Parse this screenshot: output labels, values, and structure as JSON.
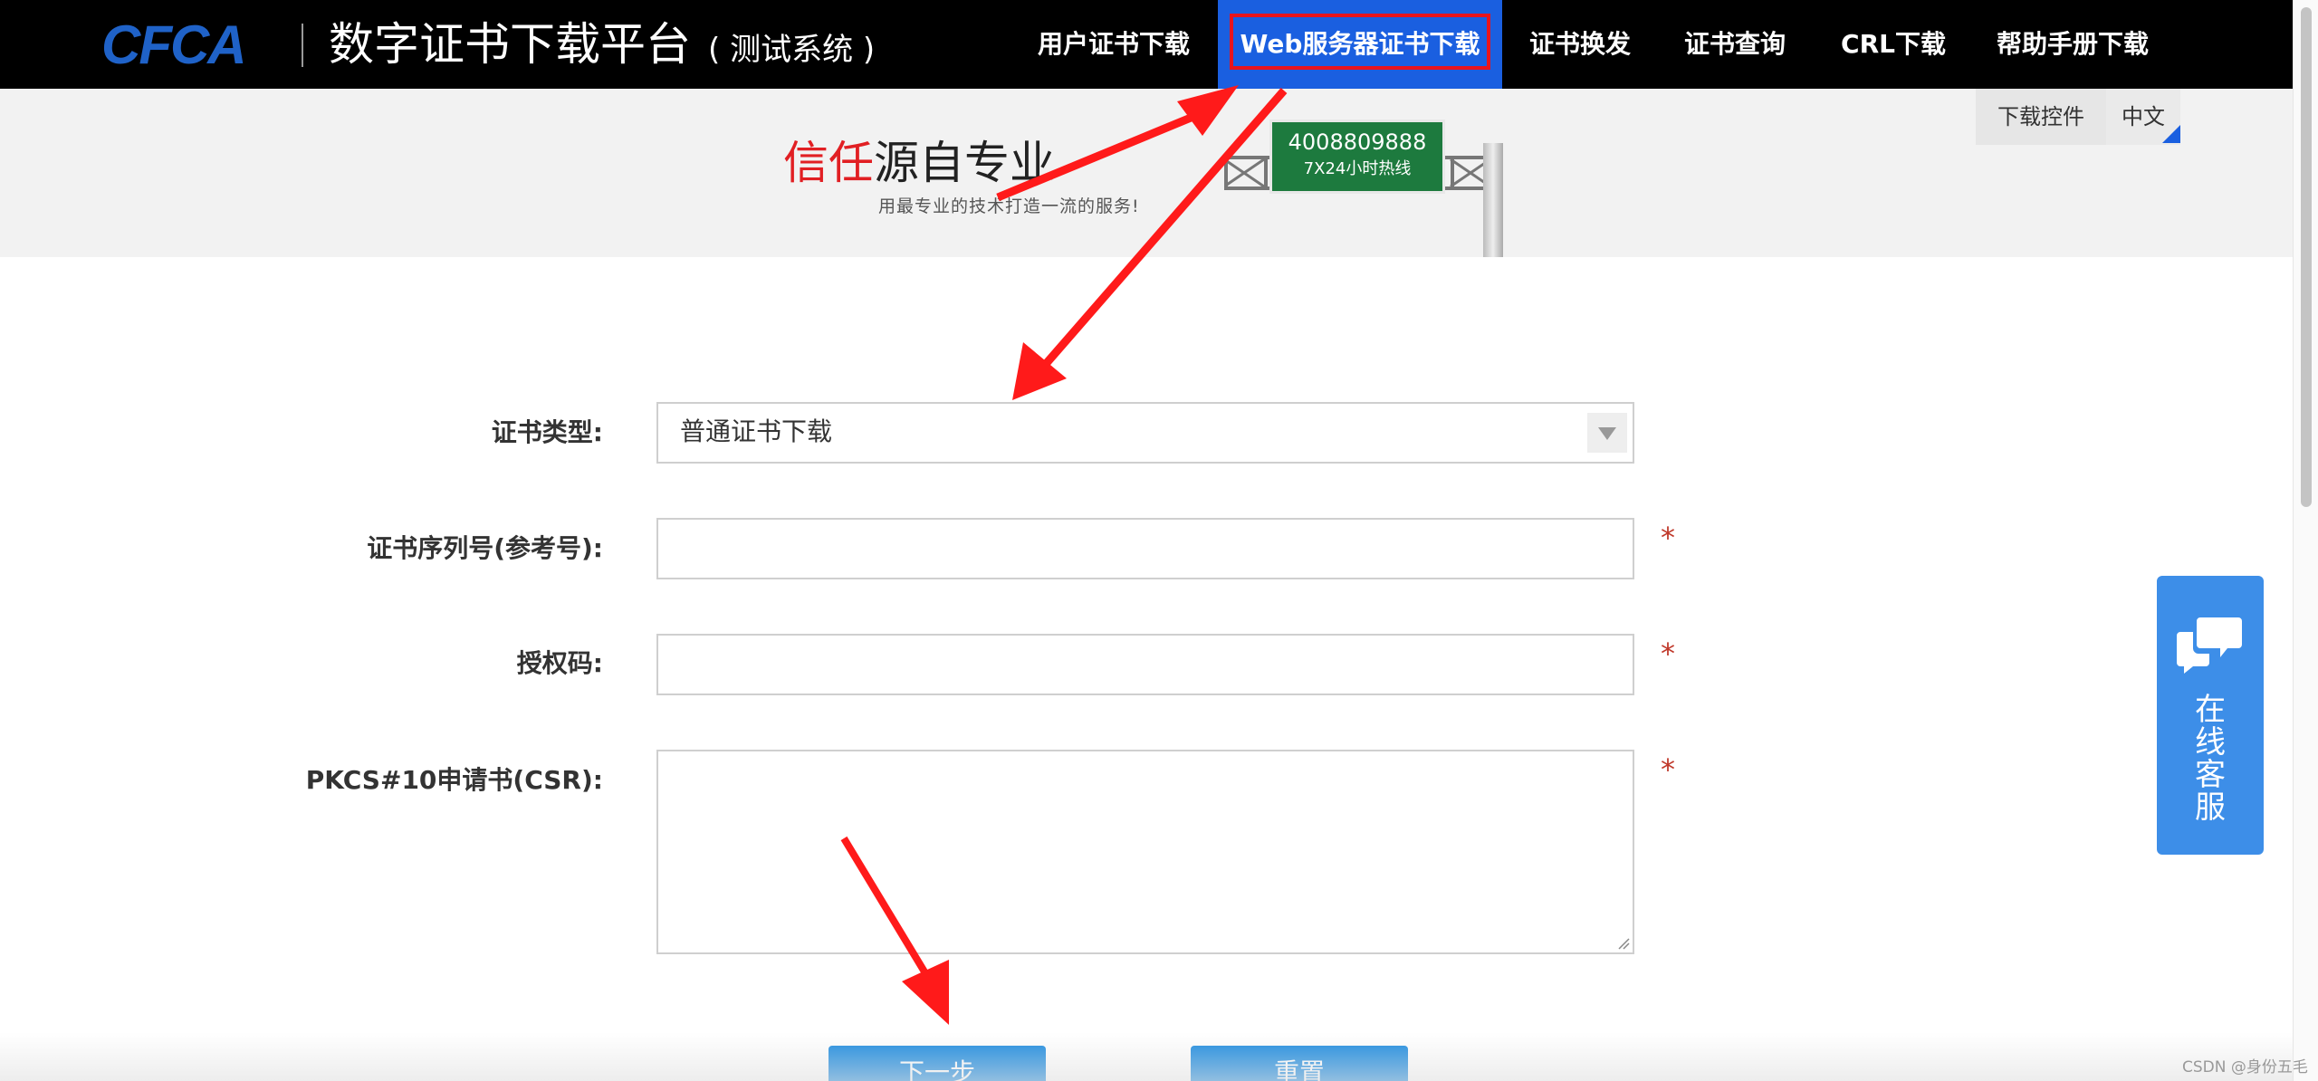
{
  "header": {
    "logo": "CFCA",
    "title": "数字证书下载平台",
    "subtitle": "( 测试系统 )",
    "nav": [
      {
        "label": "用户证书下载",
        "active": false
      },
      {
        "label": "Web服务器证书下载",
        "active": true
      },
      {
        "label": "证书换发",
        "active": false
      },
      {
        "label": "证书查询",
        "active": false
      },
      {
        "label": "CRL下载",
        "active": false
      },
      {
        "label": "帮助手册下载",
        "active": false
      }
    ],
    "utility": {
      "download_plugin": "下载控件",
      "language": "中文"
    }
  },
  "banner": {
    "slogan_red": "信任",
    "slogan_rest": "源自专业",
    "slogan_sub": "用最专业的技术打造一流的服务!",
    "hotline_number": "4008809888",
    "hotline_label": "7X24小时热线"
  },
  "form": {
    "cert_type_label": "证书类型:",
    "cert_type_value": "普通证书下载",
    "serial_label": "证书序列号(参考号):",
    "serial_value": "",
    "auth_label": "授权码:",
    "auth_value": "",
    "csr_label": "PKCS#10申请书(CSR):",
    "csr_value": "",
    "required_mark": "*",
    "next_button": "下一步",
    "reset_button": "重置"
  },
  "service": {
    "chars": [
      "在",
      "线",
      "客",
      "服"
    ]
  },
  "watermark": "CSDN @身份五毛",
  "colors": {
    "nav_active": "#1a5fe0",
    "highlight": "#e8141c",
    "button": "#1a8ae0",
    "chat": "#3d8ee8",
    "annotation_arrow": "#ff1a1a"
  }
}
